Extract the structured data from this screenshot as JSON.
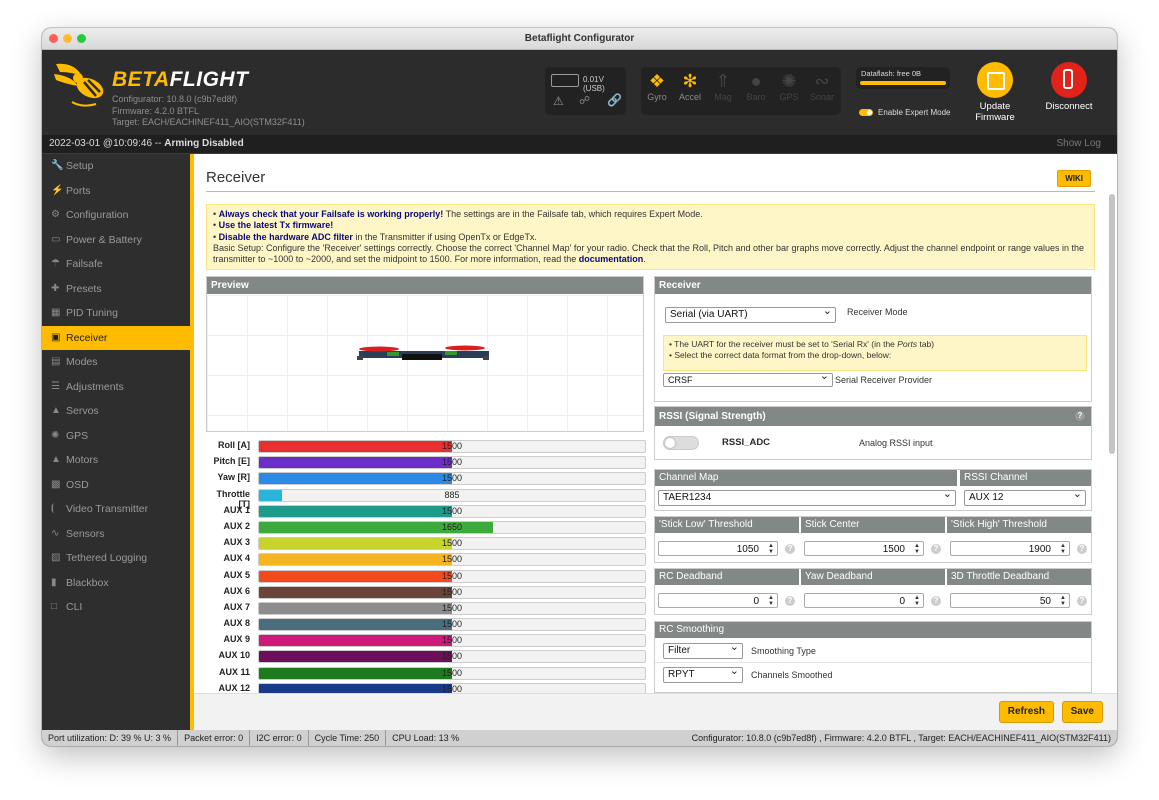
{
  "window": {
    "title": "Betaflight Configurator"
  },
  "header": {
    "logo_beta": "BETA",
    "logo_flight": "FLIGHT",
    "configurator_version": "Configurator: 10.8.0 (c9b7ed8f)",
    "firmware_version": "Firmware: 4.2.0 BTFL",
    "target": "Target: EACH/EACHINEF411_AIO(STM32F411)",
    "battery_voltage": "0.01V (USB)",
    "sensors": [
      {
        "label": "Gyro",
        "icon": "gyro-icon",
        "active": true
      },
      {
        "label": "Accel",
        "icon": "accel-icon",
        "active": true
      },
      {
        "label": "Mag",
        "icon": "mag-icon",
        "active": false
      },
      {
        "label": "Baro",
        "icon": "baro-icon",
        "active": false
      },
      {
        "label": "GPS",
        "icon": "gps-icon",
        "active": false
      },
      {
        "label": "Sonar",
        "icon": "sonar-icon",
        "active": false
      }
    ],
    "dataflash_label": "Dataflash: free 0B",
    "expert_mode_label": "Enable Expert Mode",
    "update_firmware_label": "Update Firmware",
    "disconnect_label": "Disconnect"
  },
  "status": {
    "timestamp": "2022-03-01 @10:09:46 --",
    "state": "Arming Disabled",
    "show_log": "Show Log"
  },
  "sidebar": {
    "items": [
      {
        "label": "Setup",
        "icon": "wrench-icon"
      },
      {
        "label": "Ports",
        "icon": "plug-icon"
      },
      {
        "label": "Configuration",
        "icon": "gear-icon"
      },
      {
        "label": "Power & Battery",
        "icon": "battery-icon"
      },
      {
        "label": "Failsafe",
        "icon": "parachute-icon"
      },
      {
        "label": "Presets",
        "icon": "presets-icon"
      },
      {
        "label": "PID Tuning",
        "icon": "pid-icon"
      },
      {
        "label": "Receiver",
        "icon": "receiver-icon",
        "active": true
      },
      {
        "label": "Modes",
        "icon": "modes-icon"
      },
      {
        "label": "Adjustments",
        "icon": "sliders-icon"
      },
      {
        "label": "Servos",
        "icon": "servo-icon"
      },
      {
        "label": "GPS",
        "icon": "satellite-icon"
      },
      {
        "label": "Motors",
        "icon": "motor-icon"
      },
      {
        "label": "OSD",
        "icon": "osd-icon"
      },
      {
        "label": "Video Transmitter",
        "icon": "antenna-icon"
      },
      {
        "label": "Sensors",
        "icon": "pulse-icon"
      },
      {
        "label": "Tethered Logging",
        "icon": "log-icon"
      },
      {
        "label": "Blackbox",
        "icon": "blackbox-icon"
      },
      {
        "label": "CLI",
        "icon": "terminal-icon"
      }
    ]
  },
  "page": {
    "title": "Receiver",
    "wiki": "WIKI",
    "note": {
      "l1_bold": "Always check that your Failsafe is working properly!",
      "l1_rest": " The settings are in the Failsafe tab, which requires Expert Mode.",
      "l2_bold": "Use the latest Tx firmware!",
      "l3_bold": "Disable the hardware ADC filter",
      "l3_rest": " in the Transmitter if using OpenTx or EdgeTx.",
      "l4": "Basic Setup: Configure the 'Receiver' settings correctly. Choose the correct 'Channel Map' for your radio. Check that the Roll, Pitch and other bar graphs move correctly. Adjust the channel endpoint or range values in the transmitter to ~1000 to ~2000, and set the midpoint to 1500. For more information, read the ",
      "l4_link": "documentation",
      "l4_end": "."
    },
    "preview_title": "Preview",
    "channels": [
      {
        "name": "Roll [A]",
        "value": 1500,
        "color": "#e83030"
      },
      {
        "name": "Pitch [E]",
        "value": 1500,
        "color": "#6c2ec8"
      },
      {
        "name": "Yaw [R]",
        "value": 1500,
        "color": "#2a8ae6"
      },
      {
        "name": "Throttle [T]",
        "value": 885,
        "color": "#29b4d8"
      },
      {
        "name": "AUX 1",
        "value": 1500,
        "color": "#1d9a8a"
      },
      {
        "name": "AUX 2",
        "value": 1650,
        "color": "#3caa3c"
      },
      {
        "name": "AUX 3",
        "value": 1500,
        "color": "#c8d42e"
      },
      {
        "name": "AUX 4",
        "value": 1500,
        "color": "#f5b520"
      },
      {
        "name": "AUX 5",
        "value": 1500,
        "color": "#f24a1c"
      },
      {
        "name": "AUX 6",
        "value": 1500,
        "color": "#6a4438"
      },
      {
        "name": "AUX 7",
        "value": 1500,
        "color": "#8d8d8d"
      },
      {
        "name": "AUX 8",
        "value": 1500,
        "color": "#4a6e80"
      },
      {
        "name": "AUX 9",
        "value": 1500,
        "color": "#d0187a"
      },
      {
        "name": "AUX 10",
        "value": 1500,
        "color": "#6c0e5a"
      },
      {
        "name": "AUX 11",
        "value": 1500,
        "color": "#1f7a1f"
      },
      {
        "name": "AUX 12",
        "value": 1500,
        "color": "#183a88"
      }
    ],
    "receiver": {
      "title": "Receiver",
      "mode_value": "Serial (via UART)",
      "mode_label": "Receiver Mode",
      "hint1": "• The UART for the receiver must be set to 'Serial Rx' (in the ",
      "hint1_em": "Ports",
      "hint1_end": " tab)",
      "hint2": "• Select the correct data format from the drop-down, below:",
      "provider_value": "CRSF",
      "provider_label": "Serial Receiver Provider"
    },
    "rssi": {
      "title": "RSSI (Signal Strength)",
      "toggle_label": "RSSI_ADC",
      "desc": "Analog RSSI input"
    },
    "channel_map": {
      "title": "Channel Map",
      "value": "TAER1234",
      "rssi_title": "RSSI Channel",
      "rssi_value": "AUX 12"
    },
    "thresholds": {
      "low_title": "'Stick Low' Threshold",
      "low": "1050",
      "center_title": "Stick Center",
      "center": "1500",
      "high_title": "'Stick High' Threshold",
      "high": "1900"
    },
    "deadband": {
      "rc_title": "RC Deadband",
      "rc": "0",
      "yaw_title": "Yaw Deadband",
      "yaw": "0",
      "throttle_title": "3D Throttle Deadband",
      "throttle": "50"
    },
    "smoothing": {
      "title": "RC Smoothing",
      "type_value": "Filter",
      "type_label": "Smoothing Type",
      "channels_value": "RPYT",
      "channels_label": "Channels Smoothed"
    },
    "refresh": "Refresh",
    "save": "Save"
  },
  "bottom": {
    "port_util": "Port utilization: D: 39 % U: 3 %",
    "packet_error": "Packet error: 0",
    "i2c_error": "I2C error: 0",
    "cycle_time": "Cycle Time: 250",
    "cpu_load": "CPU Load: 13 %",
    "versions": "Configurator: 10.8.0 (c9b7ed8f) , Firmware: 4.2.0 BTFL , Target: EACH/EACHINEF411_AIO(STM32F411)"
  },
  "colors": {
    "accent": "#ffbb00",
    "header_bg": "#2c2c2c",
    "sidebar_bg": "#2e2e2e"
  }
}
